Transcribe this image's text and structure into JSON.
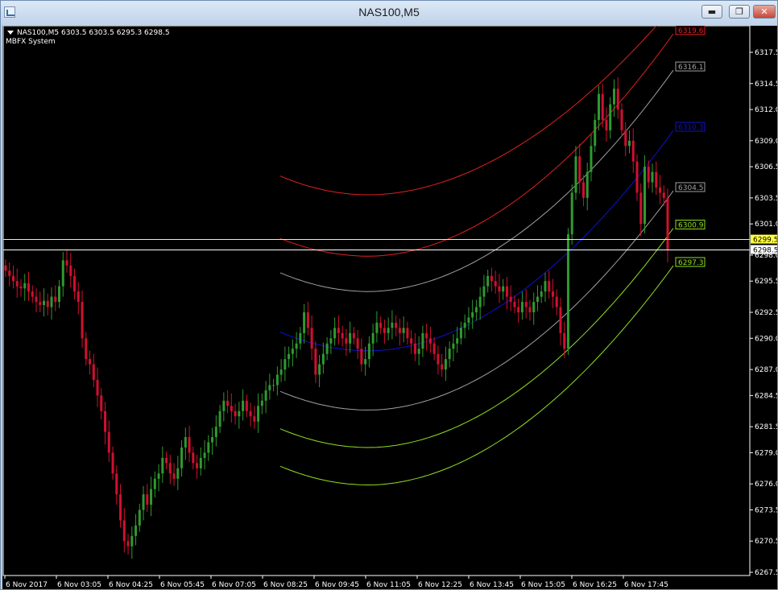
{
  "window": {
    "title": "NAS100,M5",
    "minimize_icon": "minimize-icon",
    "maximize_icon": "restore-icon",
    "close_icon": "close-icon"
  },
  "header": {
    "symbol_line": "NAS100,M5  6303.5 6303.5 6295.3 6298.5",
    "indicator": "MBFX System"
  },
  "colors": {
    "background": "#000000",
    "bull_candle": "#2f9a2f",
    "bear_candle": "#d01030",
    "red_band": "#e02020",
    "gray_band": "#a0a0a0",
    "blue_band": "#1010d0",
    "green_band": "#90e020",
    "yellow_line": "#ffff40",
    "price_line": "#ffffff"
  },
  "chart_data": {
    "type": "candlestick",
    "symbol": "NAS100",
    "timeframe": "M5",
    "ohlc_last": {
      "open": 6303.5,
      "high": 6303.5,
      "low": 6295.3,
      "close": 6298.5
    },
    "ylim": [
      6266.5,
      6320.5
    ],
    "y_ticks": [
      "6317.5",
      "6314.5",
      "6312.0",
      "6309.0",
      "6306.5",
      "6303.5",
      "6301.0",
      "6298.0",
      "6295.5",
      "6292.5",
      "6290.0",
      "6287.0",
      "6284.5",
      "6281.5",
      "6279.0",
      "6276.0",
      "6273.5",
      "6270.5",
      "6267.5"
    ],
    "x_ticks": [
      "6 Nov 2017",
      "6 Nov 03:05",
      "6 Nov 04:25",
      "6 Nov 05:45",
      "6 Nov 07:05",
      "6 Nov 08:25",
      "6 Nov 09:45",
      "6 Nov 11:05",
      "6 Nov 12:25",
      "6 Nov 13:45",
      "6 Nov 15:05",
      "6 Nov 16:25",
      "6 Nov 17:45"
    ],
    "horizontal_lines": [
      {
        "label": "6299.5",
        "value": 6299.5,
        "color": "#ffff40"
      },
      {
        "label": "6298.5",
        "value": 6298.5,
        "color": "#ffffff"
      }
    ],
    "band_labels": [
      {
        "label": "6319.6",
        "value": 6319.6,
        "color": "#e02020"
      },
      {
        "label": "6316.1",
        "value": 6316.1,
        "color": "#a0a0a0"
      },
      {
        "label": "6310.3",
        "value": 6310.3,
        "color": "#1010d0"
      },
      {
        "label": "6304.5",
        "value": 6304.5,
        "color": "#a0a0a0"
      },
      {
        "label": "6300.9",
        "value": 6300.9,
        "color": "#90e020"
      },
      {
        "label": "6297.3",
        "value": 6297.3,
        "color": "#90e020"
      }
    ],
    "grid": false
  }
}
